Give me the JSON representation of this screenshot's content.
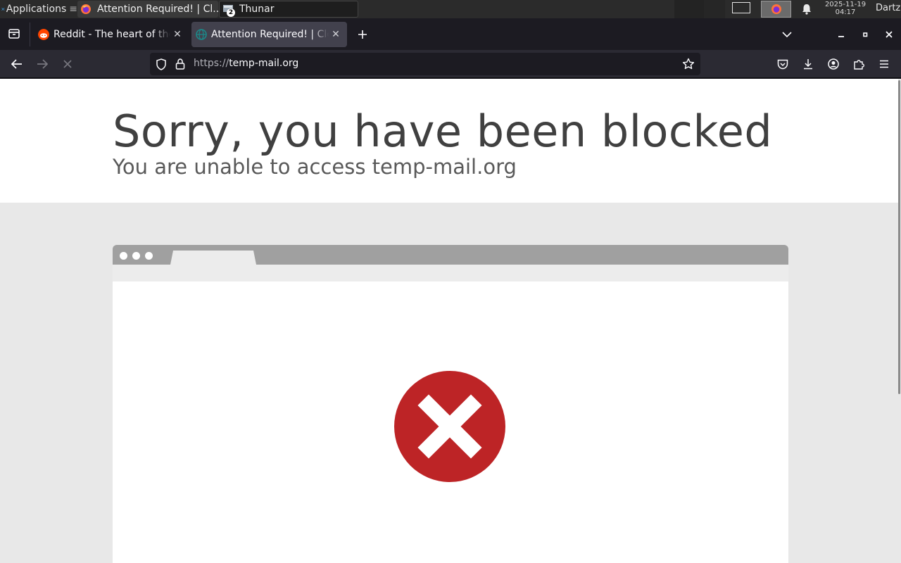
{
  "taskbar": {
    "apps_label": "Applications",
    "tasks": [
      {
        "label": "Attention Required! | Cl..."
      },
      {
        "label": "Thunar",
        "badge": "2"
      }
    ],
    "clock_date": "2025-11-19",
    "clock_time": "04:17",
    "user": "Dartz"
  },
  "browser": {
    "tabs": [
      {
        "label": "Reddit - The heart of the internet",
        "active": false
      },
      {
        "label": "Attention Required! | Cloudflare",
        "active": true
      }
    ],
    "url_scheme": "https://",
    "url_host": "temp-mail.org"
  },
  "page": {
    "heading": "Sorry, you have been blocked",
    "subheading": "You are unable to access temp-mail.org"
  },
  "colors": {
    "error_red": "#bd2426",
    "reddit_orange": "#ff4500",
    "cloudflare_teal": "#1a8a8a"
  }
}
